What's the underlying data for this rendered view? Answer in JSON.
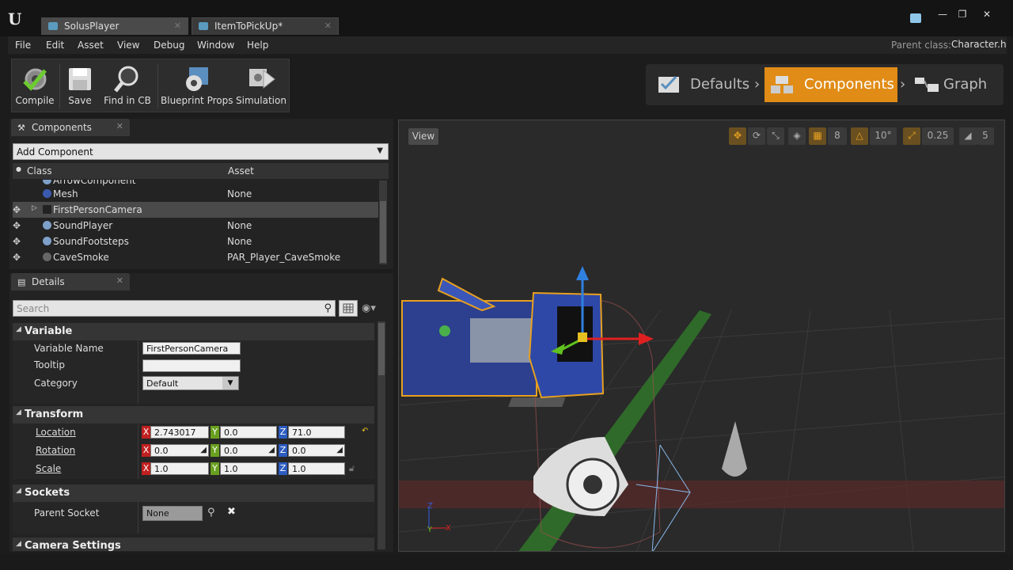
{
  "tabs": [
    {
      "label": "SolusPlayer",
      "active": true
    },
    {
      "label": "ItemToPickUp*",
      "active": false
    }
  ],
  "window_controls": {
    "minimize": "—",
    "maximize": "❐",
    "close": "✕"
  },
  "menu": [
    "File",
    "Edit",
    "Asset",
    "View",
    "Debug",
    "Window",
    "Help"
  ],
  "parent_class": {
    "label": "Parent class:",
    "value": "Character.h"
  },
  "toolbar": {
    "compile": "Compile",
    "save": "Save",
    "find_in_cb": "Find in CB",
    "blueprint_props": "Blueprint Props",
    "simulation": "Simulation"
  },
  "modes": {
    "defaults": "Defaults",
    "components": "Components",
    "graph": "Graph",
    "active": "Components"
  },
  "components_panel": {
    "tab": "Components",
    "add_component": "Add Component",
    "col_class": "Class",
    "col_asset": "Asset",
    "rows": [
      {
        "name": "ArrowComponent",
        "asset": ""
      },
      {
        "name": "Mesh",
        "asset": "None"
      },
      {
        "name": "FirstPersonCamera",
        "asset": ""
      },
      {
        "name": "SoundPlayer",
        "asset": "None"
      },
      {
        "name": "SoundFootsteps",
        "asset": "None"
      },
      {
        "name": "CaveSmoke",
        "asset": "PAR_Player_CaveSmoke"
      }
    ]
  },
  "details_panel": {
    "tab": "Details",
    "search_placeholder": "Search",
    "variable": {
      "title": "Variable",
      "name_label": "Variable Name",
      "name_value": "FirstPersonCamera",
      "tooltip_label": "Tooltip",
      "tooltip_value": "",
      "category_label": "Category",
      "category_value": "Default"
    },
    "transform": {
      "title": "Transform",
      "location_label": "Location",
      "location": {
        "x": "2.743017",
        "y": "0.0",
        "z": "71.0"
      },
      "rotation_label": "Rotation",
      "rotation": {
        "x": "0.0",
        "y": "0.0",
        "z": "0.0"
      },
      "scale_label": "Scale",
      "scale": {
        "x": "1.0",
        "y": "1.0",
        "z": "1.0"
      }
    },
    "sockets": {
      "title": "Sockets",
      "parent_socket_label": "Parent Socket",
      "parent_socket_value": "None"
    },
    "camera_settings_title": "Camera Settings"
  },
  "axis_labels": {
    "x": "X",
    "y": "Y",
    "z": "Z"
  },
  "viewport": {
    "view_button": "View",
    "grid_snap": "8",
    "rotation_snap": "10°",
    "scale_snap": "0.25",
    "camera_speed": "5",
    "axis_gizmo": {
      "x": "X",
      "y": "Y",
      "z": "Z"
    }
  }
}
